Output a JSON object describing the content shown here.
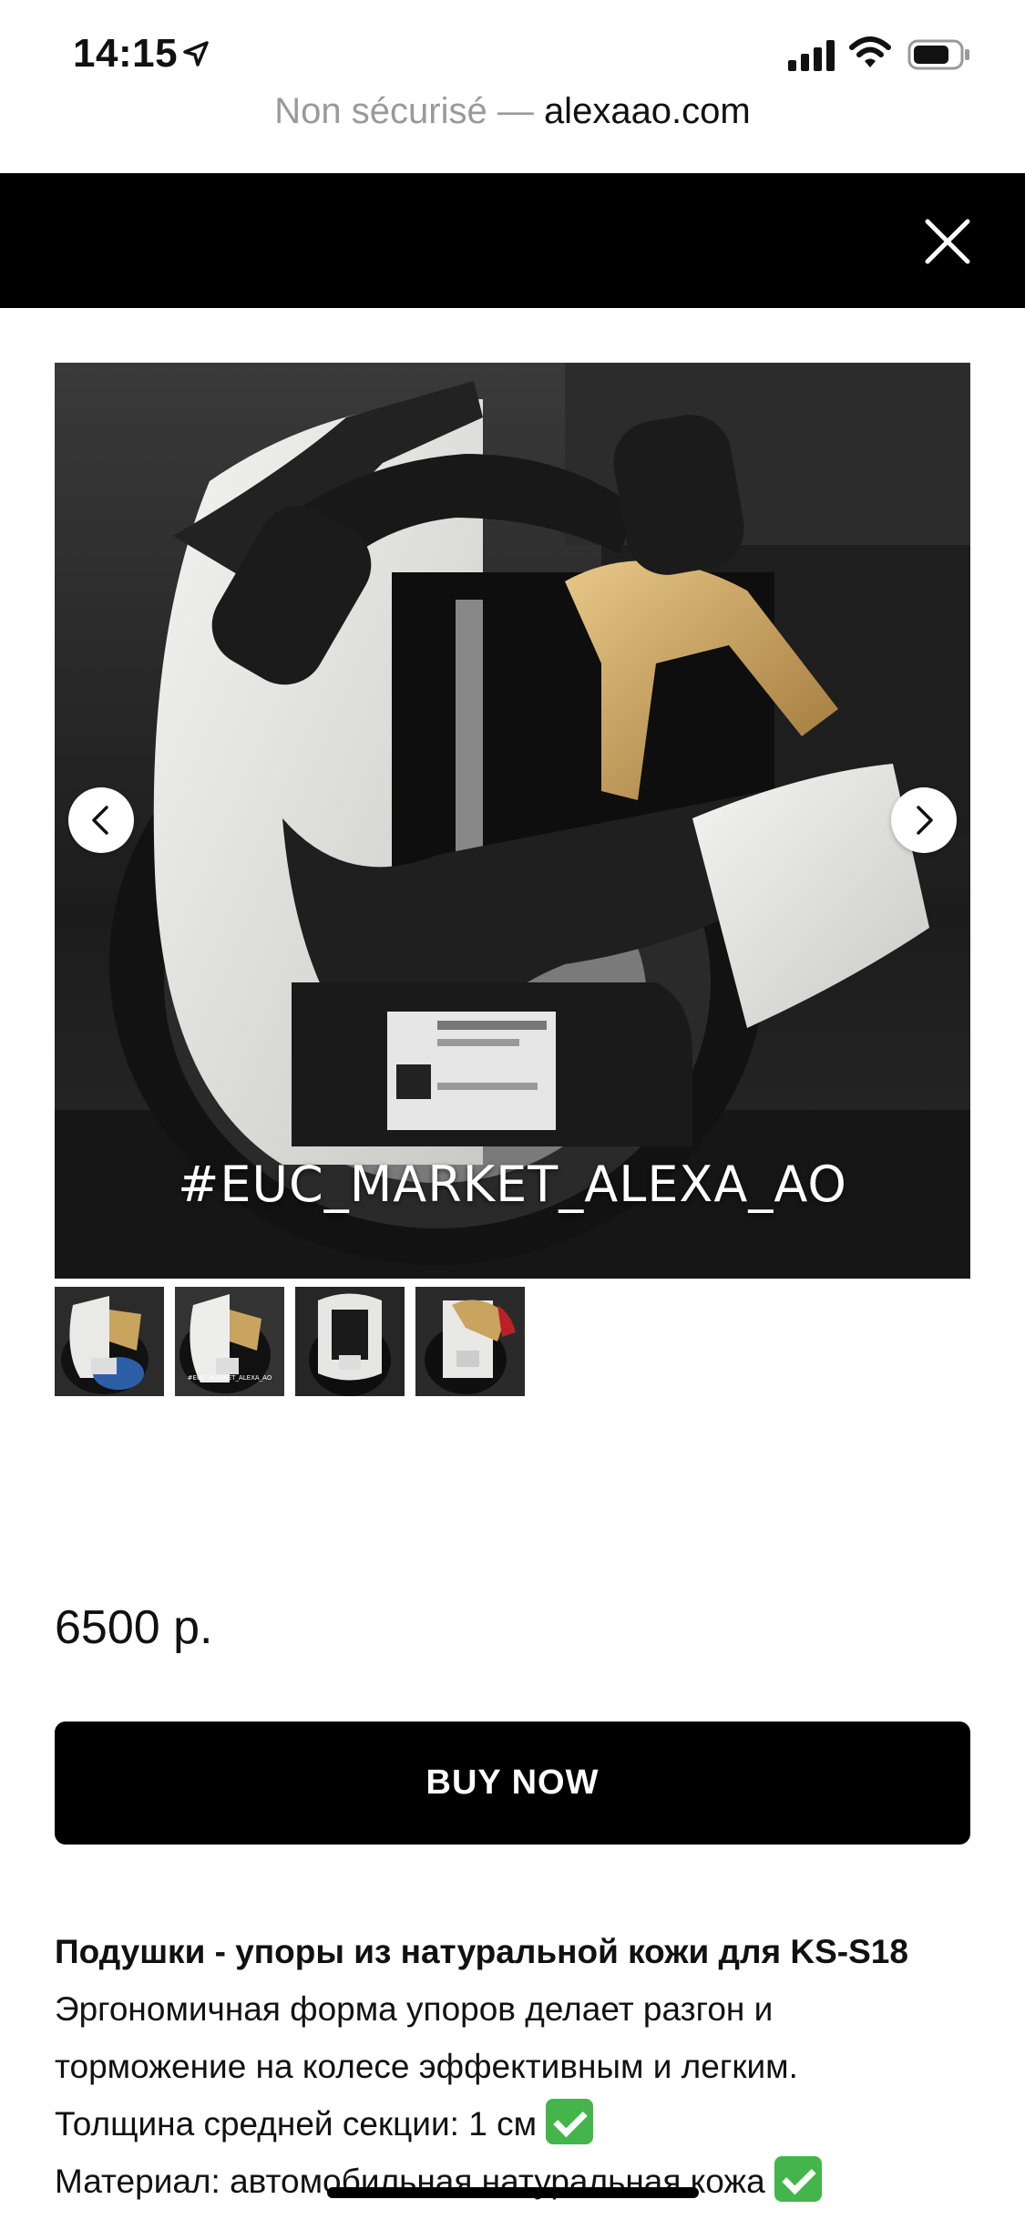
{
  "status": {
    "time": "14:15"
  },
  "browser": {
    "security": "Non sécurisé — ",
    "domain": "alexaao.com"
  },
  "gallery": {
    "watermark": "#EUC_MARKET_ALEXA_AO",
    "thumb_count": 4,
    "thumb_watermarks": [
      "",
      "#EUC_MARKET_ALEXA_AO",
      "",
      ""
    ]
  },
  "product": {
    "price": "6500 р.",
    "buy_label": "BUY NOW",
    "title": "Подушки - упоры из натуральной кожи для KS-S18",
    "desc_1": "Эргономичная форма упоров делает разгон и",
    "desc_2": "торможение на колесе эффективным и легким.",
    "desc_3": "Толщина средней секции: 1 см ",
    "desc_4": "Материал: автомобильная натуральная кожа "
  },
  "colors": {
    "header": "#000000",
    "button": "#000000",
    "check": "#43b54a"
  }
}
